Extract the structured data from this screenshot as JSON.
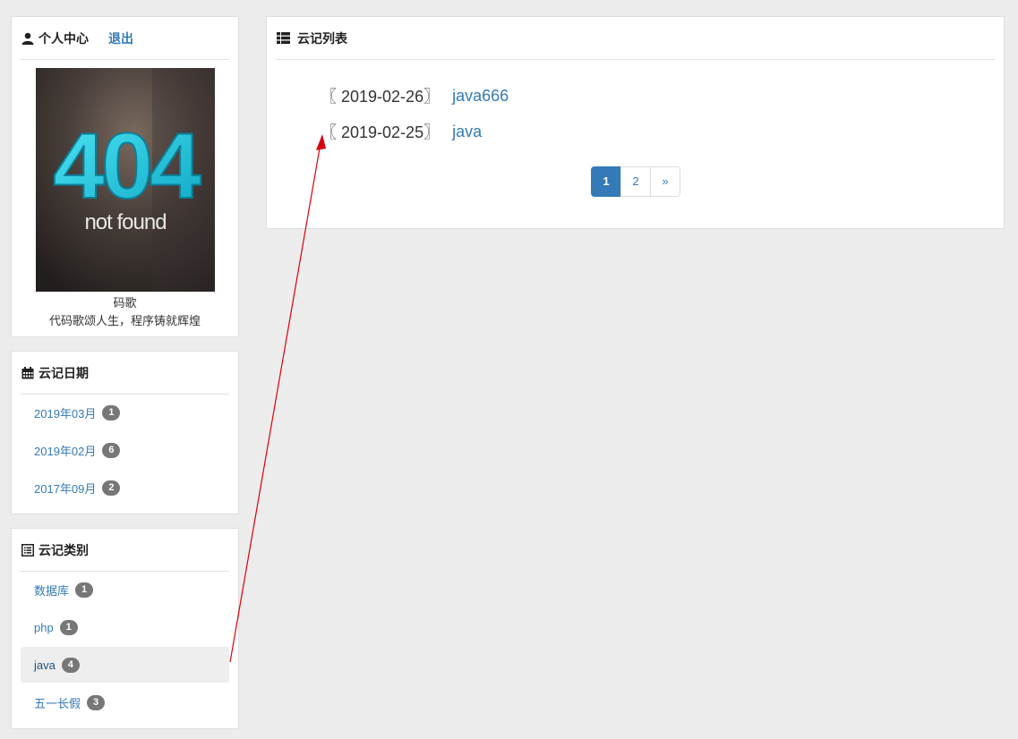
{
  "profile": {
    "title": "个人中心",
    "logout": "退出",
    "icon": "user-icon",
    "avatar": {
      "big_text": "404",
      "sub_text": "not found"
    },
    "name": "码歌",
    "motto": "代码歌颂人生，程序铸就辉煌"
  },
  "dates": {
    "title": "云记日期",
    "icon": "calendar-icon",
    "items": [
      {
        "label": "2019年03月",
        "count": "1"
      },
      {
        "label": "2019年02月",
        "count": "6"
      },
      {
        "label": "2017年09月",
        "count": "2"
      }
    ]
  },
  "categories": {
    "title": "云记类别",
    "icon": "list-alt-icon",
    "items": [
      {
        "label": "数据库",
        "count": "1"
      },
      {
        "label": "php",
        "count": "1"
      },
      {
        "label": "java",
        "count": "4"
      },
      {
        "label": "五一长假",
        "count": "3"
      }
    ],
    "active_index": 2
  },
  "notes": {
    "title": "云记列表",
    "icon": "th-list-icon",
    "items": [
      {
        "date": "〖 2019-02-26〗",
        "title": "java666"
      },
      {
        "date": "〖 2019-02-25〗",
        "title": "java"
      }
    ]
  },
  "pagination": {
    "pages": [
      "1",
      "2",
      "»"
    ],
    "current": "1"
  },
  "colors": {
    "link": "#337ab7",
    "badge": "#777777",
    "annotation_arrow": "#d9000d",
    "background": "#ececec"
  }
}
